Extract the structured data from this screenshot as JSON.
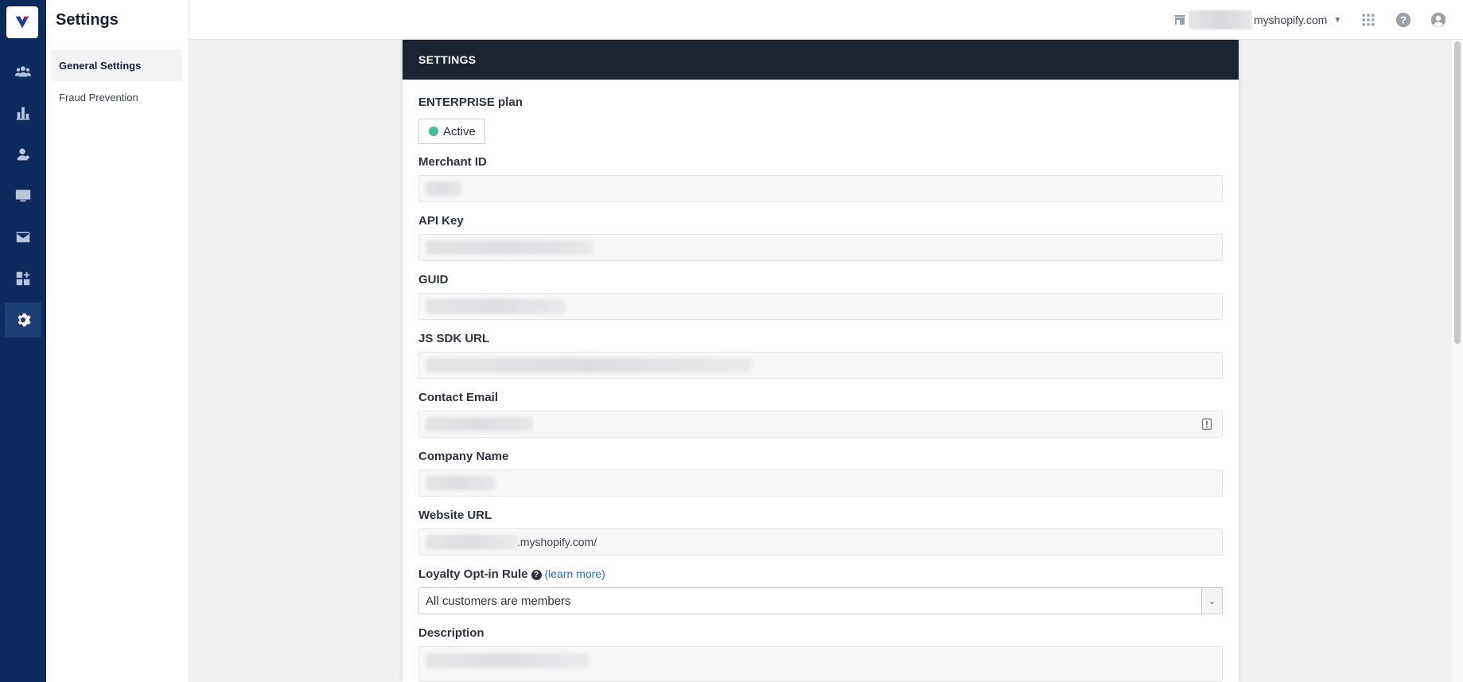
{
  "sidebar": {
    "title": "Settings",
    "items": [
      {
        "label": "General Settings",
        "active": true
      },
      {
        "label": "Fraud Prevention",
        "active": false
      }
    ]
  },
  "rail": {
    "icons": [
      "customers-icon",
      "analytics-icon",
      "member-icon",
      "display-icon",
      "email-icon",
      "integrations-icon",
      "settings-icon"
    ],
    "active": "settings-icon"
  },
  "topbar": {
    "store_domain": "myshopify.com",
    "icons": [
      "store-icon",
      "apps-grid-icon",
      "help-icon",
      "account-icon"
    ]
  },
  "panel": {
    "header": "SETTINGS",
    "plan_label": "ENTERPRISE plan",
    "status": "Active",
    "fields": {
      "merchant_id": {
        "label": "Merchant ID",
        "value": ""
      },
      "api_key": {
        "label": "API Key",
        "value": ""
      },
      "guid": {
        "label": "GUID",
        "value": ""
      },
      "js_sdk_url": {
        "label": "JS SDK URL",
        "value": ""
      },
      "contact_email": {
        "label": "Contact Email",
        "value": ""
      },
      "company_name": {
        "label": "Company Name",
        "value": ""
      },
      "website_url": {
        "label": "Website URL",
        "value": ".myshopify.com/"
      },
      "loyalty_rule": {
        "label": "Loyalty Opt-in Rule",
        "learn_more": "(learn more)",
        "value": "All customers are members"
      },
      "description": {
        "label": "Description",
        "value": ""
      }
    }
  },
  "colors": {
    "rail_bg": "#0c2a5b",
    "panel_header_bg": "#1b2430",
    "status_dot": "#3cc19b",
    "link": "#2c6ecb"
  }
}
